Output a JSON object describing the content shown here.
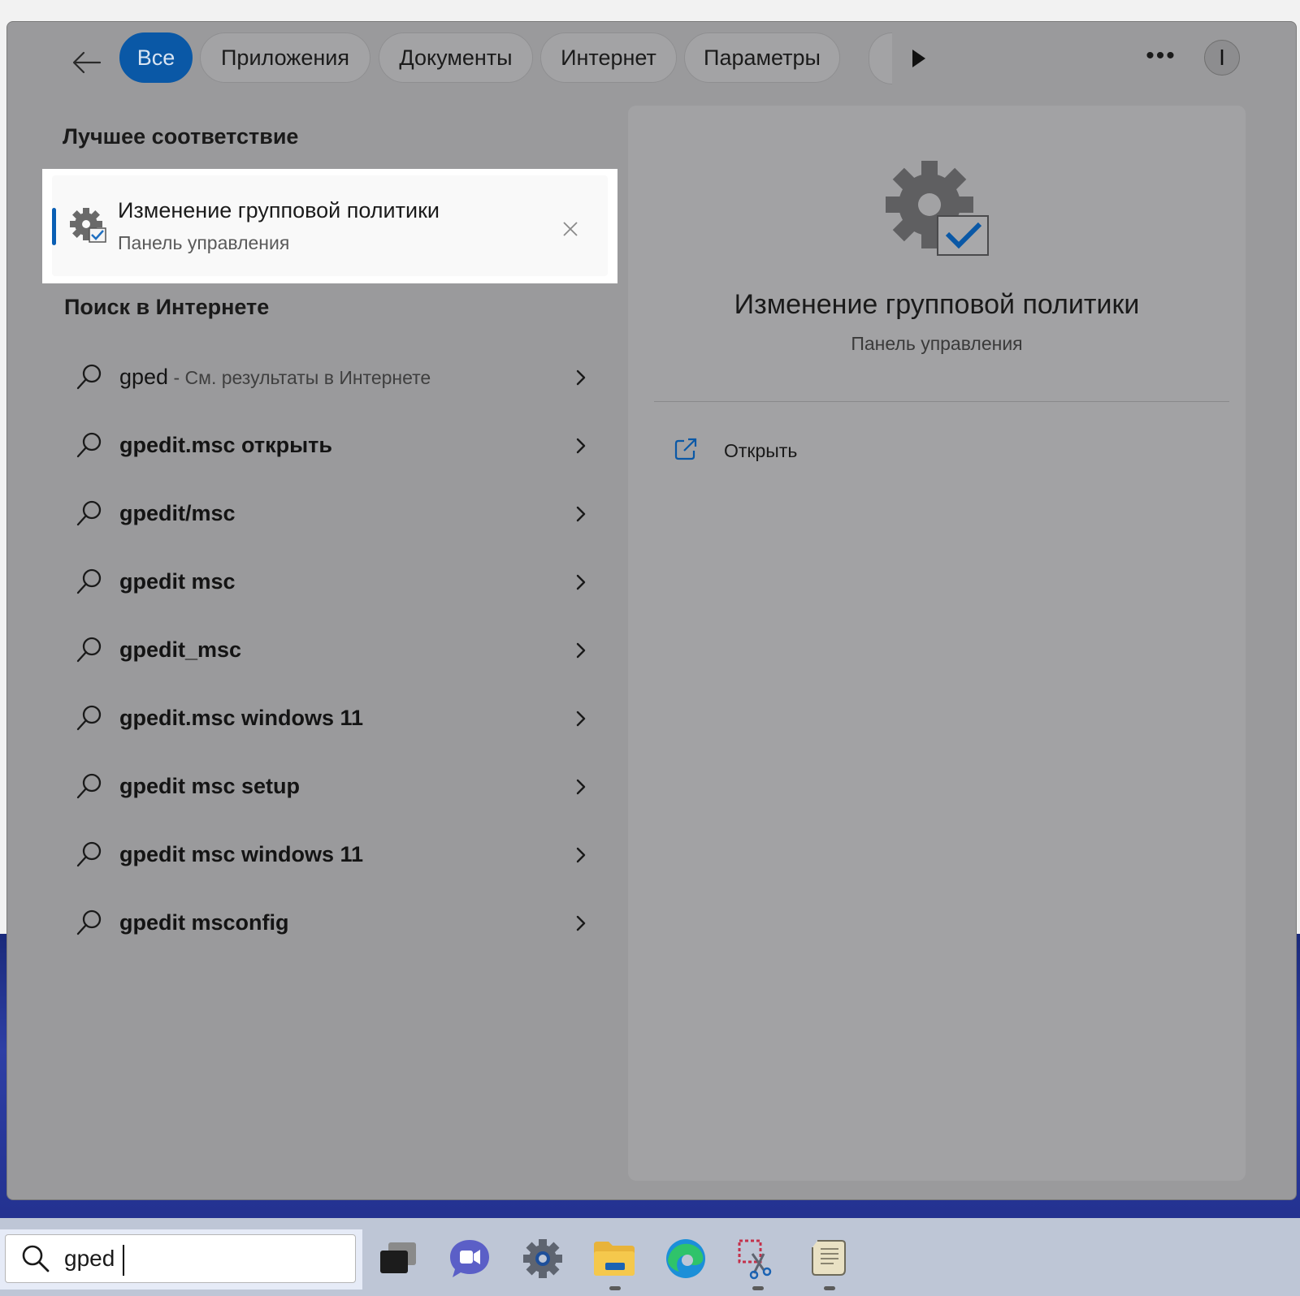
{
  "filters": {
    "back_label": "Назад",
    "tabs": [
      {
        "label": "Все",
        "active": true
      },
      {
        "label": "Приложения",
        "active": false
      },
      {
        "label": "Документы",
        "active": false
      },
      {
        "label": "Интернет",
        "active": false
      },
      {
        "label": "Параметры",
        "active": false
      }
    ],
    "more_label": "•••",
    "avatar_initial": "I"
  },
  "best_match": {
    "heading": "Лучшее соответствие",
    "title": "Изменение групповой политики",
    "subtitle": "Панель управления",
    "icon": "group-policy-gear-check-icon"
  },
  "web_search": {
    "heading": "Поиск в Интернете",
    "first": {
      "query": "gped",
      "hint": " - См. результаты в Интернете"
    },
    "suggestions": [
      "gpedit.msc открыть",
      "gpedit/msc",
      "gpedit msc",
      "gpedit_msc",
      "gpedit.msc windows 11",
      "gpedit msc setup",
      "gpedit msc windows 11",
      "gpedit msconfig"
    ]
  },
  "preview": {
    "title": "Изменение групповой политики",
    "subtitle": "Панель управления",
    "actions": [
      {
        "label": "Открыть",
        "icon": "open-external-icon"
      }
    ]
  },
  "taskbar": {
    "search_value": "gped",
    "apps": [
      {
        "name": "task-view-icon"
      },
      {
        "name": "chat-icon"
      },
      {
        "name": "settings-icon"
      },
      {
        "name": "file-explorer-icon"
      },
      {
        "name": "edge-icon"
      },
      {
        "name": "snipping-tool-icon"
      },
      {
        "name": "notepad-scroll-icon"
      }
    ]
  },
  "colors": {
    "accent": "#0a58a6",
    "panel": "#9a9a9c",
    "taskbar": "#bec6d6"
  }
}
